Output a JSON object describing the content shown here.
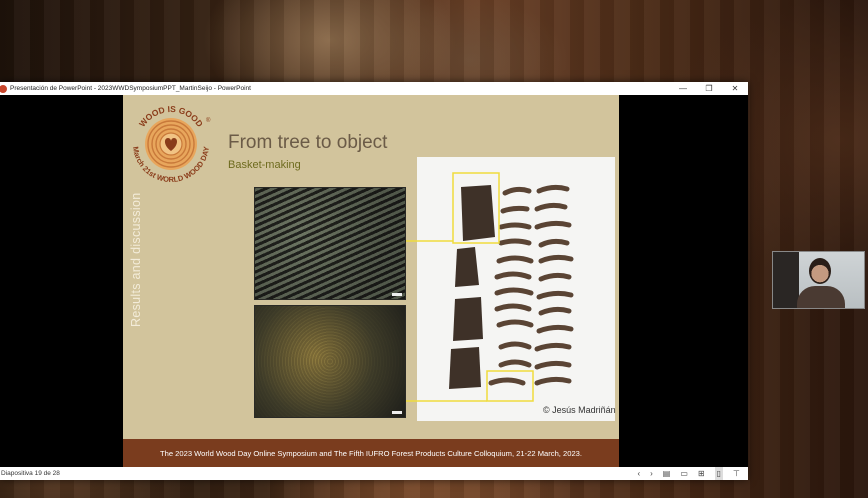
{
  "window": {
    "title": "Presentación de PowerPoint  -  2023WWDSymposiumPPT_MartinSeijo  -  PowerPoint",
    "minimize_glyph": "—",
    "restore_glyph": "❐",
    "close_glyph": "✕"
  },
  "slide": {
    "logo_text_top": "WOOD IS GOOD",
    "logo_text_bottom": "March 21st WORLD WOOD DAY",
    "logo_registered": "®",
    "side_label": "Results and discussion",
    "title": "From tree to object",
    "subtitle": "Basket-making",
    "credit": "© Jesús Madriñán",
    "footer": "The 2023 World Wood Day Online Symposium and The Fifth IUFRO Forest Products Culture Colloquium, 21-22 March, 2023."
  },
  "statusbar": {
    "slide_counter": "Diapositiva 19 de 28"
  },
  "colors": {
    "slide_bg": "#d2c49c",
    "footer_band": "#7a3c1e",
    "highlight_box": "#f0dc3c",
    "title_text": "#6b5b47",
    "subtitle_text": "#6e6b1e"
  },
  "icons": {
    "app": "powerpoint-icon",
    "prev": "chevron-left-icon",
    "next": "chevron-right-icon",
    "notes": "notes-icon",
    "normal_view": "normal-view-icon",
    "slide_sorter": "slide-sorter-icon",
    "reading_view": "reading-view-icon",
    "slideshow": "slideshow-icon"
  }
}
